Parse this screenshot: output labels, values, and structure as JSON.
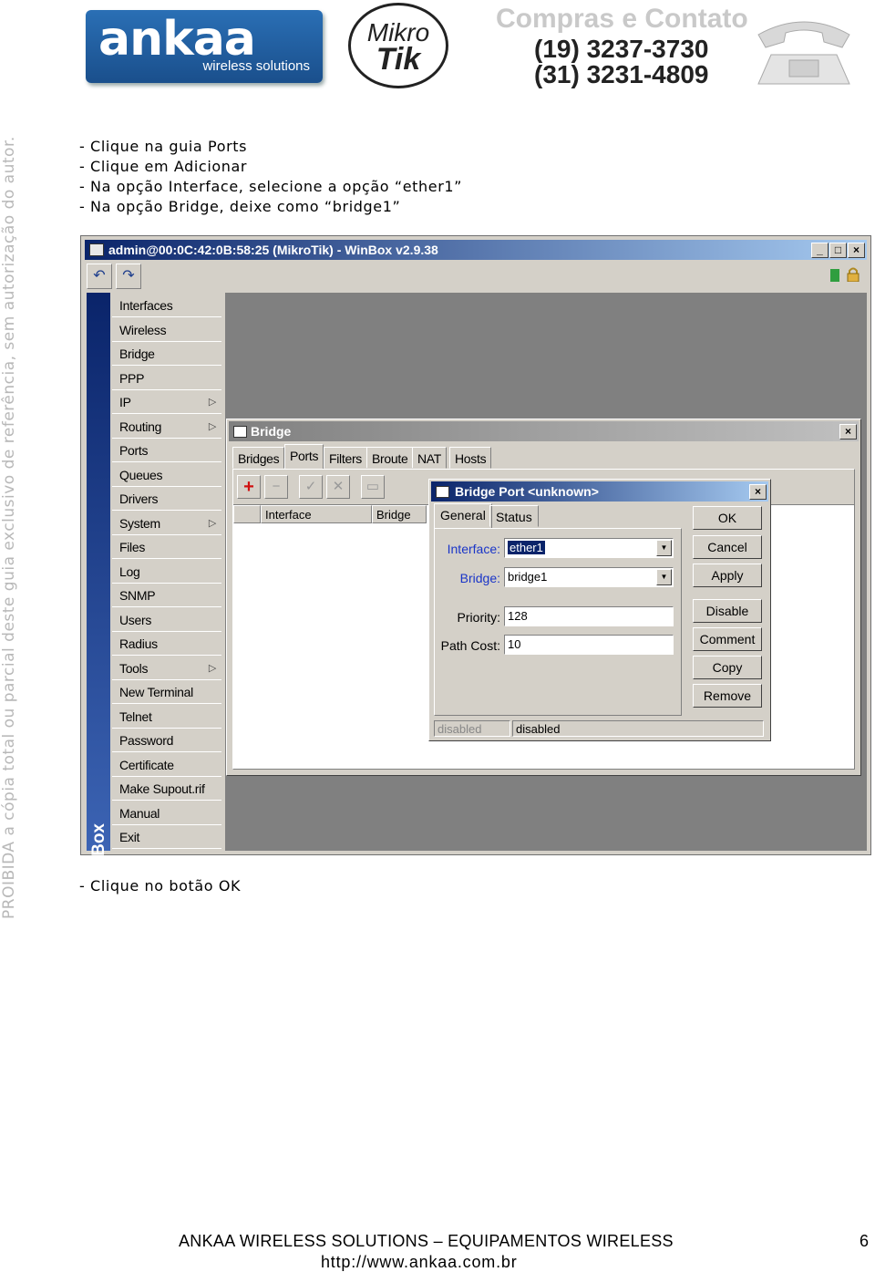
{
  "header": {
    "ankaa_logo_word": "ankaa",
    "ankaa_logo_sub": "wireless solutions",
    "mikrotik_logo_line1": "Mikro",
    "mikrotik_logo_line2": "Tik",
    "contact_title": "Compras e Contato",
    "phone1": "(19) 3237-3730",
    "phone2": "(31) 3231-4809"
  },
  "watermark": "PROIBIDA a cópia total ou parcial deste guia exclusivo de referência, sem autorização do autor.",
  "instructions": [
    "- Clique na guia Ports",
    "- Clique em Adicionar",
    "- Na opção Interface, selecione a opção “ether1”",
    "- Na opção Bridge, deixe como “bridge1”"
  ],
  "after_instruction": "- Clique no botão OK",
  "winbox": {
    "title": "admin@00:0C:42:0B:58:25 (MikroTik) - WinBox v2.9.38",
    "side_label": "RouterOS WinBox",
    "menu": [
      {
        "label": "Interfaces",
        "submenu": false
      },
      {
        "label": "Wireless",
        "submenu": false
      },
      {
        "label": "Bridge",
        "submenu": false
      },
      {
        "label": "PPP",
        "submenu": false
      },
      {
        "label": "IP",
        "submenu": true
      },
      {
        "label": "Routing",
        "submenu": true
      },
      {
        "label": "Ports",
        "submenu": false
      },
      {
        "label": "Queues",
        "submenu": false
      },
      {
        "label": "Drivers",
        "submenu": false
      },
      {
        "label": "System",
        "submenu": true
      },
      {
        "label": "Files",
        "submenu": false
      },
      {
        "label": "Log",
        "submenu": false
      },
      {
        "label": "SNMP",
        "submenu": false
      },
      {
        "label": "Users",
        "submenu": false
      },
      {
        "label": "Radius",
        "submenu": false
      },
      {
        "label": "Tools",
        "submenu": true
      },
      {
        "label": "New Terminal",
        "submenu": false
      },
      {
        "label": "Telnet",
        "submenu": false
      },
      {
        "label": "Password",
        "submenu": false
      },
      {
        "label": "Certificate",
        "submenu": false
      },
      {
        "label": "Make Supout.rif",
        "submenu": false
      },
      {
        "label": "Manual",
        "submenu": false
      },
      {
        "label": "Exit",
        "submenu": false
      }
    ],
    "bridge_window": {
      "title": "Bridge",
      "tabs": [
        "Bridges",
        "Ports",
        "Filters",
        "Broute",
        "NAT",
        "Hosts"
      ],
      "active_tab": "Ports",
      "columns": [
        "Interface",
        "Bridge"
      ]
    },
    "port_dialog": {
      "title": "Bridge Port <unknown>",
      "tabs": [
        "General",
        "Status"
      ],
      "interface_label": "Interface:",
      "interface_value": "ether1",
      "bridge_label": "Bridge:",
      "bridge_value": "bridge1",
      "priority_label": "Priority:",
      "priority_value": "128",
      "path_cost_label": "Path Cost:",
      "path_cost_value": "10",
      "buttons": [
        "OK",
        "Cancel",
        "Apply",
        "Disable",
        "Comment",
        "Copy",
        "Remove"
      ],
      "status_left": "disabled",
      "status_right": "disabled"
    }
  },
  "footer": {
    "company": "ANKAA WIRELESS SOLUTIONS – EQUIPAMENTOS WIRELESS",
    "url": "http://www.ankaa.com.br",
    "page": "6"
  }
}
